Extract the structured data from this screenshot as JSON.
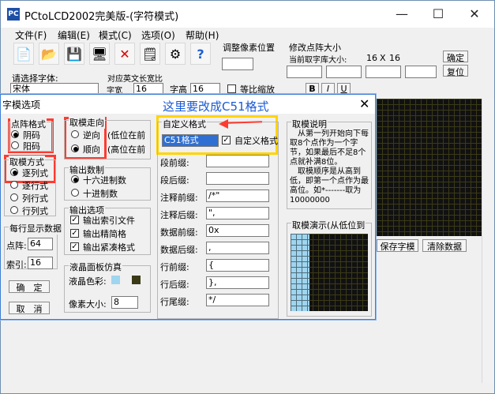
{
  "app": {
    "title": "PCtoLCD2002完美版-(字符模式)",
    "icon_text": "PC"
  },
  "window_controls": [
    "—",
    "☐",
    "✕"
  ],
  "menu": [
    "文件(F)",
    "编辑(E)",
    "模式(C)",
    "选项(O)",
    "帮助(H)"
  ],
  "toolbar": {
    "adjust_pixel": "调整像素位置",
    "edit_dot_size": "修改点阵大小",
    "current_size_label": "当前取字库大小:",
    "current_width": "16",
    "x_sign": "X",
    "current_height": "16",
    "confirm": "确定",
    "restore": "复位"
  },
  "font_bar": {
    "label": "请选择字体:",
    "font_value": "宋体",
    "width_label": "字宽",
    "width_value": "16",
    "height_label": "字高",
    "height_value": "16",
    "proportional_label": "等比缩放",
    "bold_label": "B",
    "italic_label": "I",
    "underline_label": "U",
    "font_size_hint": "对应英文长宽比"
  },
  "dialog": {
    "title": "字模选项",
    "close": "✕",
    "annotation": "这里要改成C51格式",
    "dot_format": {
      "title": "点阵格式",
      "options": [
        "阴码",
        "阳码"
      ],
      "selected": 0
    },
    "take_mode": {
      "title": "取模方式",
      "options": [
        "逐列式",
        "逐行式",
        "列行式",
        "行列式"
      ],
      "selected": 0
    },
    "take_direction": {
      "title": "取模走向",
      "options": [
        "逆向",
        "顺向"
      ],
      "notes": [
        "(低位在前",
        "(高位在前"
      ],
      "selected": 1
    },
    "output_base": {
      "title": "输出数制",
      "options": [
        "十六进制数",
        "十进制数"
      ],
      "selected": 0
    },
    "output_options": {
      "title": "输出选项",
      "items": [
        "输出索引文件",
        "输出精简格",
        "输出紧凑格式"
      ],
      "checked": [
        true,
        true,
        true
      ]
    },
    "lcd_panel": {
      "title": "液晶面板仿真",
      "color_label": "液晶色彩:",
      "pixel_label": "像素大小:",
      "pixel_value": "8"
    },
    "per_line": {
      "title": "每行显示数据",
      "dot_label": "点阵:",
      "dot_value": "64",
      "index_label": "索引:",
      "index_value": "16"
    },
    "buttons": {
      "ok": "确　定",
      "cancel": "取　消"
    },
    "custom_format": {
      "title": "自定义格式",
      "format_value": "C51格式",
      "custom_label": "自定义格式",
      "fields": [
        {
          "label": "段前缀:",
          "value": ""
        },
        {
          "label": "段后缀:",
          "value": ""
        },
        {
          "label": "注释前缀:",
          "value": "/*\""
        },
        {
          "label": "注释后缀:",
          "value": "\","
        },
        {
          "label": "数据前缀:",
          "value": "0x"
        },
        {
          "label": "数据后缀:",
          "value": ","
        },
        {
          "label": "行前缀:",
          "value": "{"
        },
        {
          "label": "行后缀:",
          "value": "},"
        },
        {
          "label": "行尾缀:",
          "value": "*/"
        }
      ]
    },
    "take_explain": {
      "title": "取模说明",
      "text": "　从第一列开始向下每取8个点作为一个字节，如果最后不足8个点就补满8位。\n　取模顺序是从高到低，即第一个点作为最高位。如*-------取为10000000"
    },
    "take_demo": {
      "title": "取模演示(从低位到"
    }
  },
  "right_panel": {
    "save_font": "保存字模",
    "clear_data": "清除数据"
  },
  "colors": {
    "lcd_light": "#9fd5ef",
    "lcd_dark": "#3b3a17",
    "annotation": "#1a5ad6",
    "highlight_yellow": "#ffd400",
    "highlight_red": "#ff3b30"
  }
}
